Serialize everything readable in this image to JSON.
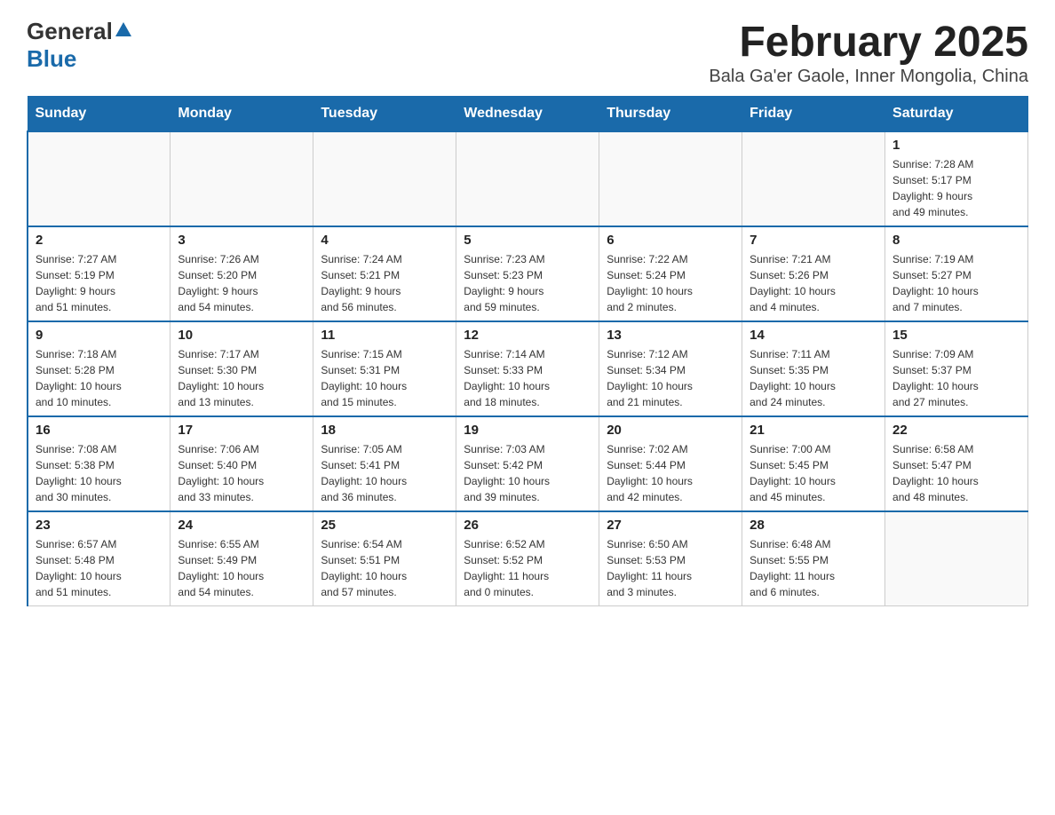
{
  "logo": {
    "general": "General",
    "blue": "Blue"
  },
  "title": "February 2025",
  "subtitle": "Bala Ga'er Gaole, Inner Mongolia, China",
  "days_of_week": [
    "Sunday",
    "Monday",
    "Tuesday",
    "Wednesday",
    "Thursday",
    "Friday",
    "Saturday"
  ],
  "weeks": [
    [
      {
        "day": "",
        "info": ""
      },
      {
        "day": "",
        "info": ""
      },
      {
        "day": "",
        "info": ""
      },
      {
        "day": "",
        "info": ""
      },
      {
        "day": "",
        "info": ""
      },
      {
        "day": "",
        "info": ""
      },
      {
        "day": "1",
        "info": "Sunrise: 7:28 AM\nSunset: 5:17 PM\nDaylight: 9 hours\nand 49 minutes."
      }
    ],
    [
      {
        "day": "2",
        "info": "Sunrise: 7:27 AM\nSunset: 5:19 PM\nDaylight: 9 hours\nand 51 minutes."
      },
      {
        "day": "3",
        "info": "Sunrise: 7:26 AM\nSunset: 5:20 PM\nDaylight: 9 hours\nand 54 minutes."
      },
      {
        "day": "4",
        "info": "Sunrise: 7:24 AM\nSunset: 5:21 PM\nDaylight: 9 hours\nand 56 minutes."
      },
      {
        "day": "5",
        "info": "Sunrise: 7:23 AM\nSunset: 5:23 PM\nDaylight: 9 hours\nand 59 minutes."
      },
      {
        "day": "6",
        "info": "Sunrise: 7:22 AM\nSunset: 5:24 PM\nDaylight: 10 hours\nand 2 minutes."
      },
      {
        "day": "7",
        "info": "Sunrise: 7:21 AM\nSunset: 5:26 PM\nDaylight: 10 hours\nand 4 minutes."
      },
      {
        "day": "8",
        "info": "Sunrise: 7:19 AM\nSunset: 5:27 PM\nDaylight: 10 hours\nand 7 minutes."
      }
    ],
    [
      {
        "day": "9",
        "info": "Sunrise: 7:18 AM\nSunset: 5:28 PM\nDaylight: 10 hours\nand 10 minutes."
      },
      {
        "day": "10",
        "info": "Sunrise: 7:17 AM\nSunset: 5:30 PM\nDaylight: 10 hours\nand 13 minutes."
      },
      {
        "day": "11",
        "info": "Sunrise: 7:15 AM\nSunset: 5:31 PM\nDaylight: 10 hours\nand 15 minutes."
      },
      {
        "day": "12",
        "info": "Sunrise: 7:14 AM\nSunset: 5:33 PM\nDaylight: 10 hours\nand 18 minutes."
      },
      {
        "day": "13",
        "info": "Sunrise: 7:12 AM\nSunset: 5:34 PM\nDaylight: 10 hours\nand 21 minutes."
      },
      {
        "day": "14",
        "info": "Sunrise: 7:11 AM\nSunset: 5:35 PM\nDaylight: 10 hours\nand 24 minutes."
      },
      {
        "day": "15",
        "info": "Sunrise: 7:09 AM\nSunset: 5:37 PM\nDaylight: 10 hours\nand 27 minutes."
      }
    ],
    [
      {
        "day": "16",
        "info": "Sunrise: 7:08 AM\nSunset: 5:38 PM\nDaylight: 10 hours\nand 30 minutes."
      },
      {
        "day": "17",
        "info": "Sunrise: 7:06 AM\nSunset: 5:40 PM\nDaylight: 10 hours\nand 33 minutes."
      },
      {
        "day": "18",
        "info": "Sunrise: 7:05 AM\nSunset: 5:41 PM\nDaylight: 10 hours\nand 36 minutes."
      },
      {
        "day": "19",
        "info": "Sunrise: 7:03 AM\nSunset: 5:42 PM\nDaylight: 10 hours\nand 39 minutes."
      },
      {
        "day": "20",
        "info": "Sunrise: 7:02 AM\nSunset: 5:44 PM\nDaylight: 10 hours\nand 42 minutes."
      },
      {
        "day": "21",
        "info": "Sunrise: 7:00 AM\nSunset: 5:45 PM\nDaylight: 10 hours\nand 45 minutes."
      },
      {
        "day": "22",
        "info": "Sunrise: 6:58 AM\nSunset: 5:47 PM\nDaylight: 10 hours\nand 48 minutes."
      }
    ],
    [
      {
        "day": "23",
        "info": "Sunrise: 6:57 AM\nSunset: 5:48 PM\nDaylight: 10 hours\nand 51 minutes."
      },
      {
        "day": "24",
        "info": "Sunrise: 6:55 AM\nSunset: 5:49 PM\nDaylight: 10 hours\nand 54 minutes."
      },
      {
        "day": "25",
        "info": "Sunrise: 6:54 AM\nSunset: 5:51 PM\nDaylight: 10 hours\nand 57 minutes."
      },
      {
        "day": "26",
        "info": "Sunrise: 6:52 AM\nSunset: 5:52 PM\nDaylight: 11 hours\nand 0 minutes."
      },
      {
        "day": "27",
        "info": "Sunrise: 6:50 AM\nSunset: 5:53 PM\nDaylight: 11 hours\nand 3 minutes."
      },
      {
        "day": "28",
        "info": "Sunrise: 6:48 AM\nSunset: 5:55 PM\nDaylight: 11 hours\nand 6 minutes."
      },
      {
        "day": "",
        "info": ""
      }
    ]
  ]
}
